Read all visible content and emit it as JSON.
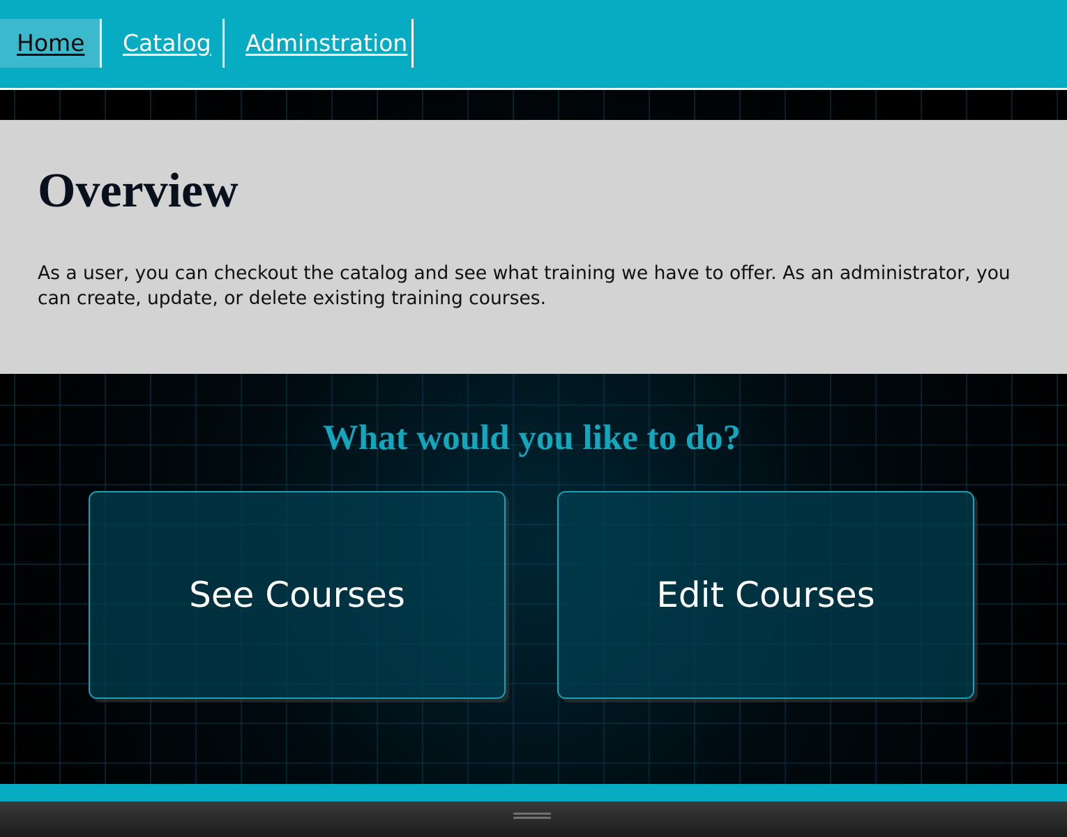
{
  "nav": {
    "items": [
      {
        "label": "Home",
        "active": true
      },
      {
        "label": "Catalog",
        "active": false
      },
      {
        "label": "Adminstration",
        "active": false
      }
    ]
  },
  "overview": {
    "title": "Overview",
    "description": "As a user, you can checkout the catalog and see what training we have to offer. As an administrator, you can create, update, or delete existing training courses."
  },
  "actions": {
    "heading": "What would you like to do?",
    "see_courses_label": "See Courses",
    "edit_courses_label": "Edit Courses"
  },
  "colors": {
    "nav_background": "#07abc2",
    "nav_active_background": "#3cb9cc",
    "overview_background": "#d3d3d3",
    "accent": "#13a6bd",
    "card_border": "#12a3bb",
    "page_background": "#000000"
  }
}
